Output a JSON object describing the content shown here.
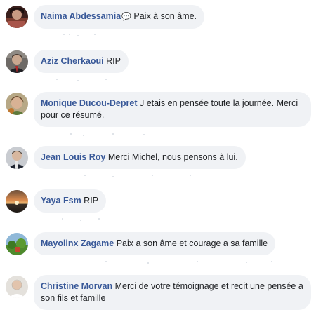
{
  "comments": [
    {
      "author": "Naima Abdessamia",
      "emoji": "💬",
      "text": "Paix à son âme.",
      "avatar": "avatar-photo-1"
    },
    {
      "author": "Aziz Cherkaoui",
      "text": "RIP",
      "avatar": "avatar-photo-2"
    },
    {
      "author": "Monique Ducou-Depret",
      "text": "J etais en pensée toute la journée. Merci pour ce résumé.",
      "avatar": "avatar-photo-3"
    },
    {
      "author": "Jean Louis Roy",
      "text": "Merci Michel, nous pensons à lui.",
      "avatar": "avatar-photo-4"
    },
    {
      "author": "Yaya Fsm",
      "text": "RIP",
      "avatar": "avatar-photo-5"
    },
    {
      "author": "Mayolinx Zagame",
      "text": "Paix a son âme et courage a sa famille",
      "avatar": "avatar-photo-6"
    },
    {
      "author": "Christine Morvan",
      "text": "Merci de votre témoignage et recit une pensée a son fils et famille",
      "avatar": "avatar-photo-7"
    }
  ],
  "colors": {
    "author_link": "#385898",
    "bubble_bg": "#f0f2f5",
    "text": "#1c1e21"
  }
}
